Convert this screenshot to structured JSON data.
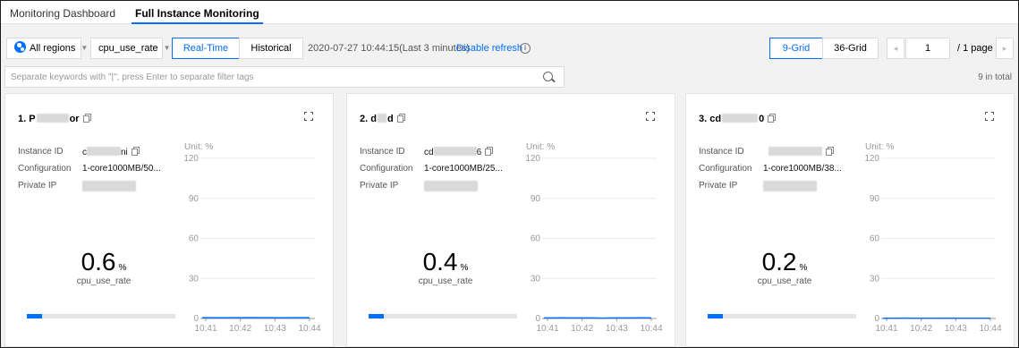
{
  "tabs": [
    {
      "label": "Monitoring Dashboard",
      "active": false
    },
    {
      "label": "Full Instance Monitoring",
      "active": true
    }
  ],
  "toolbar": {
    "region": "All regions",
    "metric": "cpu_use_rate",
    "realtime_label": "Real-Time",
    "historical_label": "Historical",
    "time_text": "2020-07-27 10:44:15(Last 3 minutes)",
    "disable_refresh": "Disable refresh",
    "info_icon": "i",
    "grid9_label": "9-Grid",
    "grid36_label": "36-Grid",
    "page_value": "1",
    "page_total": "/ 1 page",
    "prev_icon": "◂",
    "next_icon": "▸"
  },
  "search": {
    "placeholder": "Separate keywords with \"|\"; press Enter to separate filter tags"
  },
  "total_text": "9 in total",
  "labels": {
    "instance_id": "Instance ID",
    "configuration": "Configuration",
    "private_ip": "Private IP"
  },
  "cards": [
    {
      "title": "1. P",
      "title_tail": "or",
      "id_prefix": "c",
      "id_suffix": "ni",
      "configuration": "1-core1000MB/50...",
      "value": "0.6",
      "unit": "%",
      "metric": "cpu_use_rate",
      "progress": 0.1
    },
    {
      "title": "2. d",
      "title_tail": "d",
      "id_prefix": "cd",
      "id_suffix": "6",
      "configuration": "1-core1000MB/25...",
      "value": "0.4",
      "unit": "%",
      "metric": "cpu_use_rate",
      "progress": 0.1
    },
    {
      "title": "3. cd",
      "title_tail": "0",
      "id_prefix": "",
      "id_suffix": "",
      "configuration": "1-core1000MB/38...",
      "value": "0.2",
      "unit": "%",
      "metric": "cpu_use_rate",
      "progress": 0.1
    }
  ],
  "chart_data": [
    {
      "type": "line",
      "ylabel": "Unit: %",
      "ylim": [
        0,
        120
      ],
      "yticks": [
        "0",
        "30",
        "60",
        "90",
        "120"
      ],
      "xticks": [
        "10:41",
        "10:42",
        "10:43",
        "10:44"
      ],
      "grid": true,
      "series": [
        {
          "values": [
            0.6,
            0.6,
            0.5,
            0.6,
            0.6,
            0.7,
            0.6,
            0.6,
            0.5,
            0.6,
            0.6,
            0.6
          ]
        }
      ],
      "color": "#006eff"
    },
    {
      "type": "line",
      "ylabel": "Unit: %",
      "ylim": [
        0,
        120
      ],
      "yticks": [
        "0",
        "30",
        "60",
        "90",
        "120"
      ],
      "xticks": [
        "10:41",
        "10:42",
        "10:43",
        "10:44"
      ],
      "grid": true,
      "series": [
        {
          "values": [
            0.4,
            0.4,
            0.5,
            0.4,
            0.4,
            0.4,
            0.3,
            0.4,
            0.4,
            0.4,
            0.5,
            0.4
          ]
        }
      ],
      "color": "#006eff"
    },
    {
      "type": "line",
      "ylabel": "Unit: %",
      "ylim": [
        0,
        120
      ],
      "yticks": [
        "0",
        "30",
        "60",
        "90",
        "120"
      ],
      "xticks": [
        "10:41",
        "10:42",
        "10:43",
        "10:44"
      ],
      "grid": true,
      "series": [
        {
          "values": [
            0.2,
            0.2,
            0.3,
            0.2,
            0.2,
            0.2,
            0.2,
            0.3,
            0.2,
            0.2,
            0.2,
            0.2
          ]
        }
      ],
      "color": "#006eff"
    }
  ]
}
